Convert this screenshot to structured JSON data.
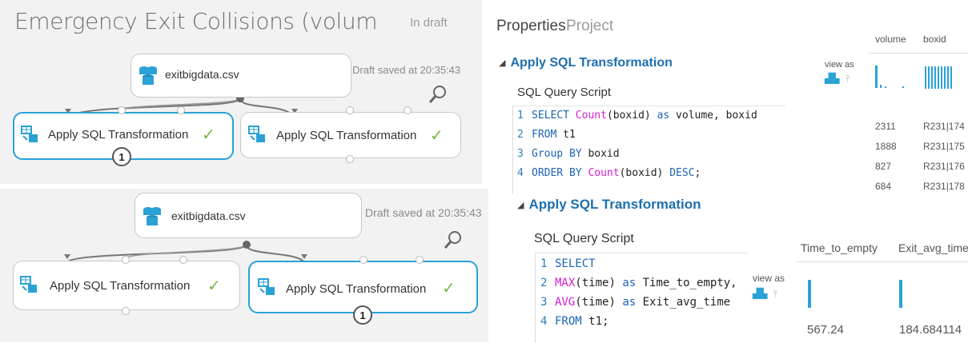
{
  "experiment": {
    "title": "Emergency Exit Collisions (volum",
    "status": "In draft"
  },
  "canvas_top": {
    "saved": "Draft saved at 20:35:43",
    "dataset_label": "exitbigdata.csv",
    "module_left_label": "Apply SQL Transformation",
    "module_right_label": "Apply SQL Transformation",
    "badge": "1"
  },
  "canvas_bottom": {
    "saved": "Draft saved at 20:35:43",
    "dataset_label": "exitbigdata.csv",
    "module_left_label": "Apply SQL Transformation",
    "module_right_label": "Apply SQL Transformation",
    "badge": "1"
  },
  "tabs": {
    "properties": "Properties",
    "project": "Project"
  },
  "section1": {
    "heading": "Apply SQL Transformation",
    "script_label": "SQL Query Script",
    "lines": [
      {
        "n": "1",
        "parts": [
          [
            "kw",
            "SELECT "
          ],
          [
            "fn",
            "Count"
          ],
          [
            "tx",
            "(boxid) "
          ],
          [
            "kw",
            "as"
          ],
          [
            "tx",
            " volume, boxid"
          ]
        ]
      },
      {
        "n": "2",
        "parts": [
          [
            "kw",
            "FROM "
          ],
          [
            "tx",
            "t1"
          ]
        ]
      },
      {
        "n": "3",
        "parts": [
          [
            "kw",
            "Group BY "
          ],
          [
            "tx",
            "boxid"
          ]
        ]
      },
      {
        "n": "4",
        "parts": [
          [
            "kw",
            "ORDER BY "
          ],
          [
            "fn",
            "Count"
          ],
          [
            "tx",
            "(boxid) "
          ],
          [
            "kw",
            "DESC"
          ],
          [
            "tx",
            ";"
          ]
        ]
      }
    ]
  },
  "result1": {
    "view_as": "view as",
    "columns": [
      "volume",
      "boxid"
    ],
    "rows": [
      [
        "2311",
        "R231|174"
      ],
      [
        "1888",
        "R231|175"
      ],
      [
        "827",
        "R231|176"
      ],
      [
        "684",
        "R231|178"
      ]
    ]
  },
  "section2": {
    "heading": "Apply SQL Transformation",
    "script_label": "SQL Query Script",
    "lines": [
      {
        "n": "1",
        "parts": [
          [
            "kw",
            "SELECT"
          ]
        ]
      },
      {
        "n": "2",
        "parts": [
          [
            "fn",
            "MAX"
          ],
          [
            "tx",
            "(time) "
          ],
          [
            "kw",
            "as"
          ],
          [
            "tx",
            " Time_to_empty,"
          ]
        ]
      },
      {
        "n": "3",
        "parts": [
          [
            "fn",
            "AVG"
          ],
          [
            "tx",
            "(time) "
          ],
          [
            "kw",
            "as"
          ],
          [
            "tx",
            " Exit_avg_time"
          ]
        ]
      },
      {
        "n": "4",
        "parts": [
          [
            "kw",
            "FROM "
          ],
          [
            "tx",
            "t1;"
          ]
        ]
      }
    ]
  },
  "result2": {
    "view_as": "view as",
    "columns": [
      "Time_to_empty",
      "Exit_avg_time"
    ],
    "values": [
      "567.24",
      "184.684114"
    ]
  },
  "colors": {
    "accent": "#2aa2d6",
    "check": "#7ab648",
    "keyword": "#1c63b7",
    "function": "#d41ed4"
  }
}
